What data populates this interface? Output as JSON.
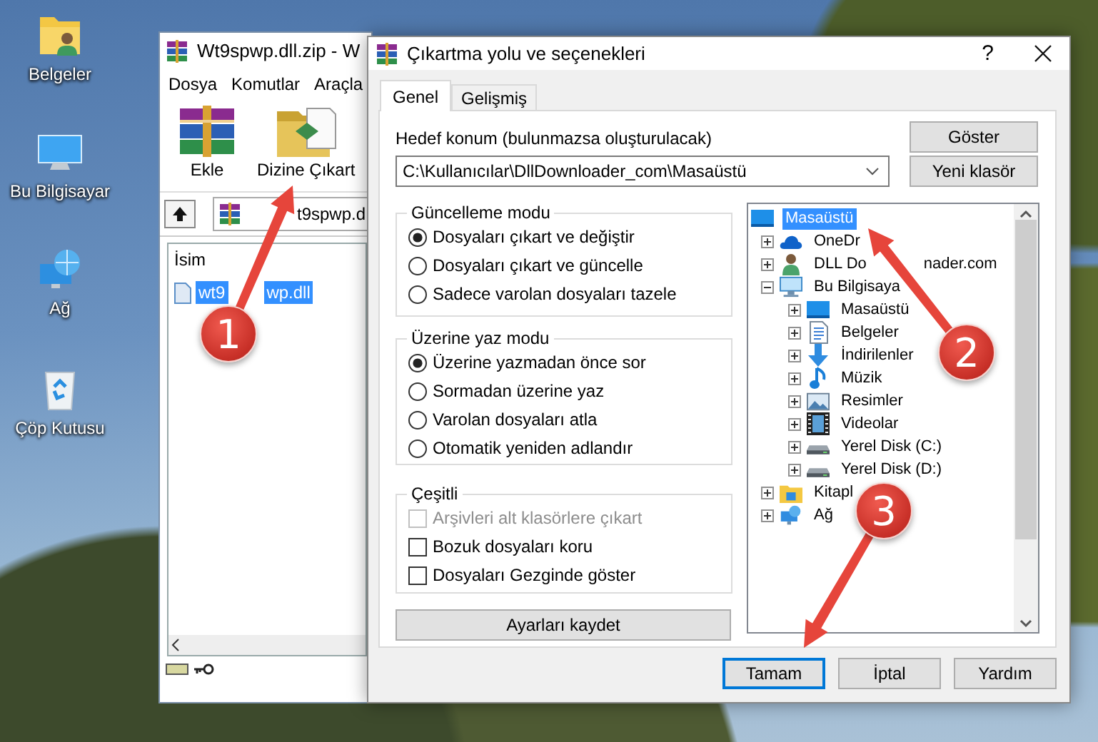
{
  "desktop_icons": [
    {
      "label": "Belgeler",
      "kind": "documents"
    },
    {
      "label": "Bu Bilgisayar",
      "kind": "computer"
    },
    {
      "label": "Ağ",
      "kind": "network"
    },
    {
      "label": "Çöp Kutusu",
      "kind": "recycle"
    }
  ],
  "archive_window": {
    "title": "Wt9spwp.dll.zip - W",
    "menu": [
      "Dosya",
      "Komutlar",
      "Araçla"
    ],
    "toolbar": [
      {
        "label": "Ekle",
        "kind": "add"
      },
      {
        "label": "Dizine Çıkart",
        "kind": "extract"
      }
    ],
    "address": "t9spwp.d",
    "columns": [
      "İsim"
    ],
    "rows": [
      {
        "name": "wt9",
        "name_tail": "wp.dll",
        "selected": true
      }
    ]
  },
  "dialog": {
    "title": "Çıkartma yolu ve seçenekleri",
    "help": "?",
    "tabs": [
      {
        "label": "Genel",
        "selected": true
      },
      {
        "label": "Gelişmiş",
        "selected": false
      }
    ],
    "destination_label": "Hedef konum (bulunmazsa oluşturulacak)",
    "destination": "C:\\Kullanıcılar\\DllDownloader_com\\Masaüstü",
    "side_buttons": [
      "Göster",
      "Yeni klasör"
    ],
    "groups": [
      {
        "title": "Güncelleme modu",
        "options": [
          {
            "label": "Dosyaları çıkart ve değiştir",
            "kind": "radio",
            "checked": true,
            "disabled": false
          },
          {
            "label": "Dosyaları çıkart ve güncelle",
            "kind": "radio",
            "checked": false,
            "disabled": false
          },
          {
            "label": "Sadece varolan dosyaları tazele",
            "kind": "radio",
            "checked": false,
            "disabled": false
          }
        ]
      },
      {
        "title": "Üzerine yaz modu",
        "options": [
          {
            "label": "Üzerine yazmadan önce sor",
            "kind": "radio",
            "checked": true,
            "disabled": false
          },
          {
            "label": "Sormadan üzerine yaz",
            "kind": "radio",
            "checked": false,
            "disabled": false
          },
          {
            "label": "Varolan dosyaları atla",
            "kind": "radio",
            "checked": false,
            "disabled": false
          },
          {
            "label": "Otomatik yeniden adlandır",
            "kind": "radio",
            "checked": false,
            "disabled": false
          }
        ]
      },
      {
        "title": "Çeşitli",
        "options": [
          {
            "label": "Arşivleri alt klasörlere çıkart",
            "kind": "checkbox",
            "checked": false,
            "disabled": true
          },
          {
            "label": "Bozuk dosyaları koru",
            "kind": "checkbox",
            "checked": false,
            "disabled": false
          },
          {
            "label": "Dosyaları Gezginde göster",
            "kind": "checkbox",
            "checked": false,
            "disabled": false
          }
        ]
      }
    ],
    "save_button": "Ayarları kaydet",
    "tree": [
      {
        "label": "Masaüstü",
        "kind": "desktop",
        "selected": true,
        "children": [
          {
            "label": "OneDr",
            "kind": "cloud",
            "selected": false,
            "expanded": false
          },
          {
            "label": "DLL Do",
            "label_tail": "nader.com",
            "kind": "user",
            "selected": false,
            "expanded": false
          },
          {
            "label": "Bu Bilgisaya",
            "kind": "computer",
            "selected": false,
            "expanded": true,
            "children": [
              {
                "label": "Masaüstü",
                "kind": "desktop",
                "selected": false,
                "expanded": false
              },
              {
                "label": "Belgeler",
                "kind": "documents",
                "selected": false,
                "expanded": false
              },
              {
                "label": "İndirilenler",
                "kind": "downloads",
                "selected": false,
                "expanded": false
              },
              {
                "label": "Müzik",
                "kind": "music",
                "selected": false,
                "expanded": false
              },
              {
                "label": "Resimler",
                "kind": "pictures",
                "selected": false,
                "expanded": false
              },
              {
                "label": "Videolar",
                "kind": "videos",
                "selected": false,
                "expanded": false
              },
              {
                "label": "Yerel Disk (C:)",
                "kind": "disk",
                "selected": false,
                "expanded": false
              },
              {
                "label": "Yerel Disk (D:)",
                "kind": "disk",
                "selected": false,
                "expanded": false
              }
            ]
          },
          {
            "label": "Kitapl",
            "kind": "libraries",
            "selected": false,
            "expanded": false
          },
          {
            "label": "Ağ",
            "kind": "network",
            "selected": false,
            "expanded": false
          }
        ]
      }
    ],
    "buttons": [
      {
        "label": "Tamam",
        "default": true
      },
      {
        "label": "İptal",
        "default": false
      },
      {
        "label": "Yardım",
        "default": false
      }
    ]
  },
  "annotations": [
    {
      "number": "1"
    },
    {
      "number": "2"
    },
    {
      "number": "3"
    }
  ]
}
